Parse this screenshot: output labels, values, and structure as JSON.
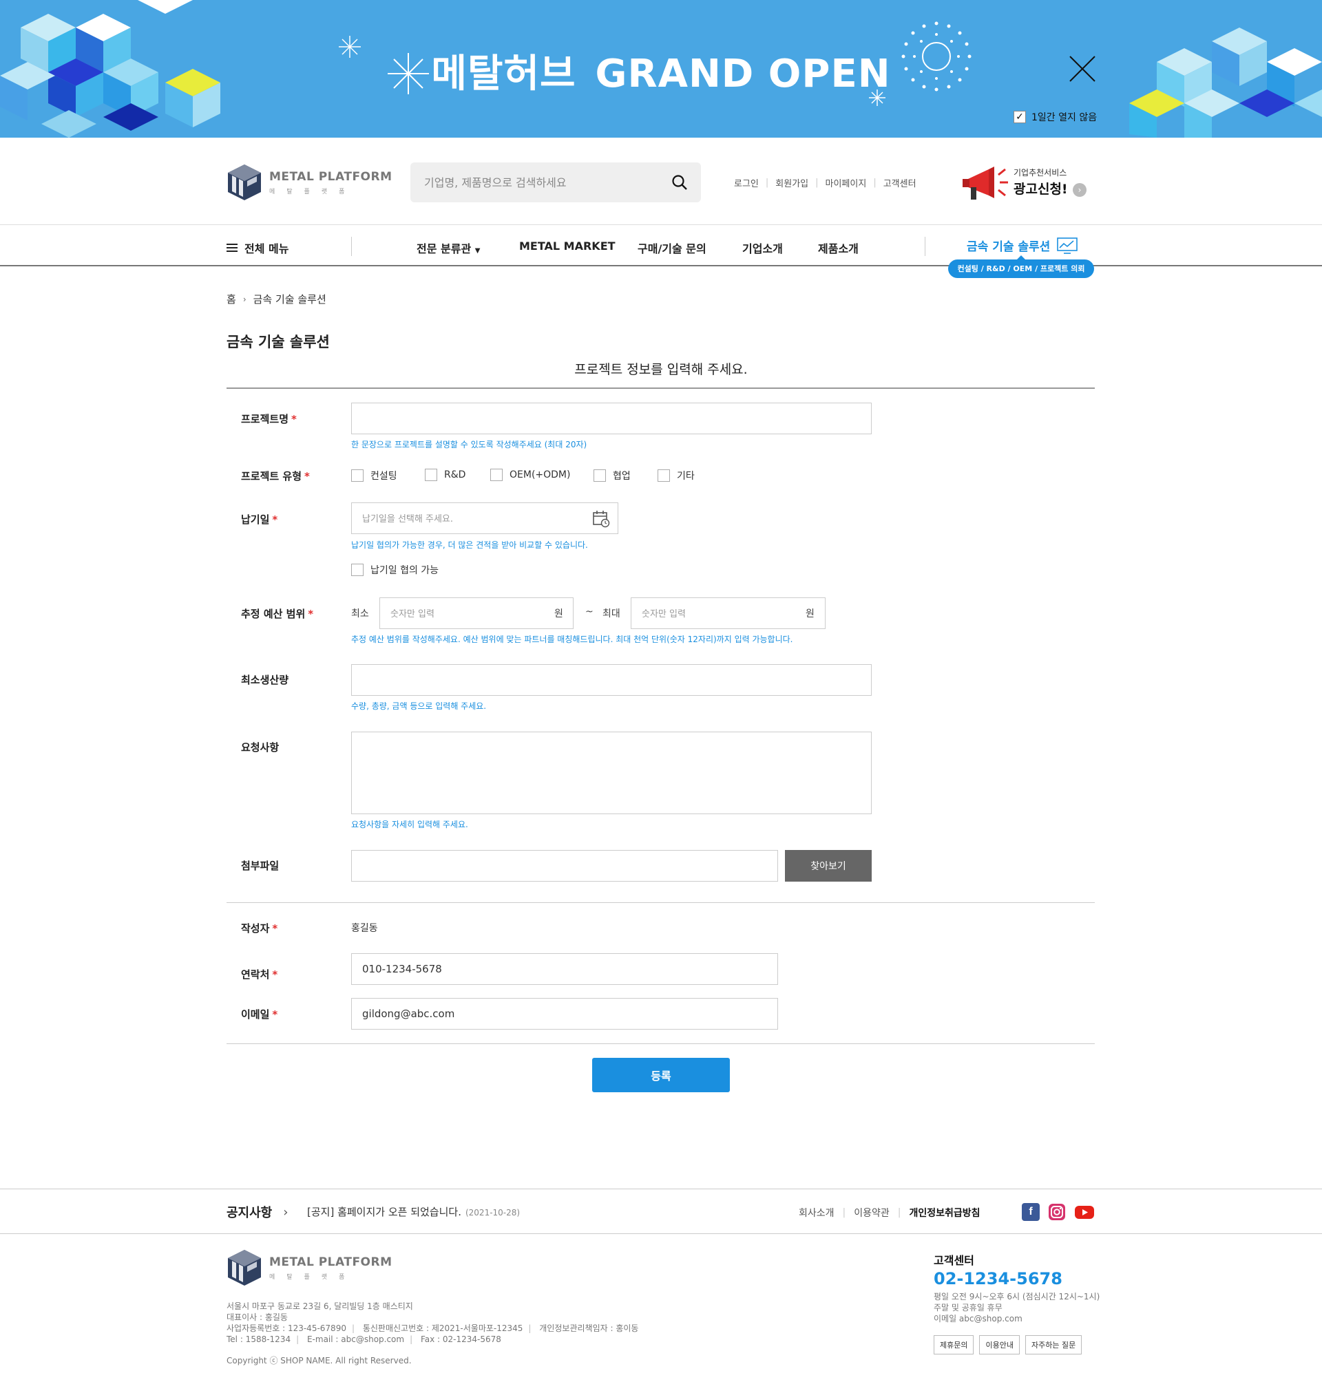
{
  "banner": {
    "title_ko": "메탈허브",
    "title_en": "GRAND OPEN",
    "dont_show_label": "1일간 열지 않음",
    "colors": {
      "background": "#49a6e3"
    }
  },
  "header": {
    "logo_en": "METAL PLATFORM",
    "logo_ko": "메탈플랫폼",
    "search_placeholder": "기업명, 제품명으로 검색하세요",
    "links": [
      "로그인",
      "회원가입",
      "마이페이지",
      "고객센터"
    ],
    "ad_sub": "기업추천서비스",
    "ad_main": "광고신청!"
  },
  "nav": {
    "all_menu": "전체 메뉴",
    "items": [
      "전문 분류관",
      "METAL MARKET",
      "구매/기술 문의",
      "기업소개",
      "제품소개"
    ],
    "solution": "금속 기술 솔루션",
    "solution_pill": "컨설팅 / R&D / OEM / 프로젝트 의뢰",
    "accent_color": "#1a8fdf"
  },
  "breadcrumb": {
    "home": "홈",
    "current": "금속 기술 솔루션"
  },
  "page_title": "금속 기술 솔루션",
  "form": {
    "heading": "프로젝트 정보를 입력해 주세요.",
    "project_name": {
      "label": "프로젝트명",
      "value": "",
      "hint": "한 문장으로 프로젝트를 설명할 수 있도록 작성해주세요 (최대 20자)"
    },
    "project_type": {
      "label": "프로젝트 유형",
      "options": [
        "컨설팅",
        "R&D",
        "OEM(+ODM)",
        "협업",
        "기타"
      ]
    },
    "due_date": {
      "label": "납기일",
      "placeholder": "납기일을 선택해 주세요.",
      "hint": "납기일 협의가 가능한 경우, 더 많은 견적을 받아 비교할 수 있습니다.",
      "negotiable_label": "납기일 협의 가능"
    },
    "budget": {
      "label": "추정 예산 범위",
      "min_label": "최소",
      "max_label": "최대",
      "tilde": "~",
      "placeholder": "숫자만 입력",
      "unit": "원",
      "hint": "추정 예산 범위를 작성해주세요. 예산 범위에 맞는 파트너를 매칭해드립니다. 최대 천억 단위(숫자 12자리)까지 입력 가능합니다."
    },
    "min_production": {
      "label": "최소생산량",
      "value": "",
      "hint": "수량, 총량, 금액 등으로 입력해 주세요."
    },
    "request": {
      "label": "요청사항",
      "value": "",
      "hint": "요청사항을 자세히 입력해 주세요."
    },
    "attachment": {
      "label": "첨부파일",
      "button": "찾아보기"
    },
    "author": {
      "label": "작성자",
      "value": "홍길동"
    },
    "contact": {
      "label": "연락처",
      "value": "010-1234-5678"
    },
    "email": {
      "label": "이메일",
      "value": "gildong@abc.com"
    },
    "required_mark": "*",
    "submit": "등록"
  },
  "footer": {
    "notice_title": "공지사항",
    "notice_text": "[공지] 홈페이지가 오픈 되었습니다.",
    "notice_date": "(2021-10-28)",
    "links": [
      "회사소개",
      "이용약관",
      "개인정보취급방침"
    ],
    "address": "서울시 마포구 동교로 23길 6, 달리빌딩 1층 매스티지",
    "ceo": "대표이사 : 홍길동",
    "biz_no": "사업자등록번호 : 123-45-67890",
    "mail_order_no": "통신판매신고번호 : 제2021-서울마포-12345",
    "privacy_officer": "개인정보관리책임자 : 홍이동",
    "tel": "Tel : 1588-1234",
    "email": "E-mail : abc@shop.com",
    "fax": "Fax : 02-1234-5678",
    "copyright": "Copyright ⓒ SHOP NAME. All right Reserved.",
    "cs_title": "고객센터",
    "cs_phone": "02-1234-5678",
    "cs_hours": "평일 오전 9시~오후 6시 (점심시간 12시~1시)",
    "cs_holiday": "주말 및 공휴일 휴무",
    "cs_email": "이메일 abc@shop.com",
    "cs_buttons": [
      "제휴문의",
      "이용안내",
      "자주하는 질문"
    ],
    "social_icons": [
      "facebook-icon",
      "instagram-icon",
      "youtube-icon"
    ]
  }
}
